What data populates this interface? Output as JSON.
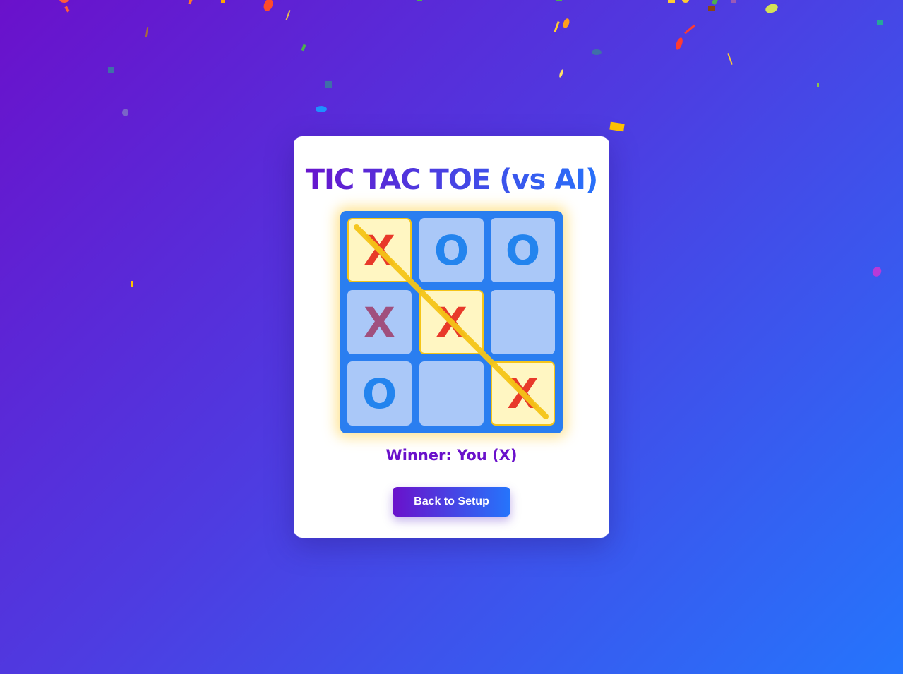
{
  "title": "TIC TAC TOE (vs AI)",
  "status": {
    "winner_text": "Winner: You (X)"
  },
  "board": {
    "cells": [
      {
        "mark": "X",
        "winning": true
      },
      {
        "mark": "O",
        "winning": false
      },
      {
        "mark": "O",
        "winning": false
      },
      {
        "mark": "X",
        "winning": false
      },
      {
        "mark": "X",
        "winning": true
      },
      {
        "mark": "",
        "winning": false
      },
      {
        "mark": "O",
        "winning": false
      },
      {
        "mark": "",
        "winning": false
      },
      {
        "mark": "X",
        "winning": true
      }
    ],
    "winning_line": "diagonal"
  },
  "buttons": {
    "back_label": "Back to Setup"
  },
  "colors": {
    "background_start": "#6a11cb",
    "background_end": "#2575fc",
    "board": "#2a7ef0",
    "cell": "#aac8f8",
    "winning_cell": "#fff6c2",
    "x_mark": "#e8392a",
    "o_mark": "#2384ee",
    "win_line": "#f5c518"
  }
}
